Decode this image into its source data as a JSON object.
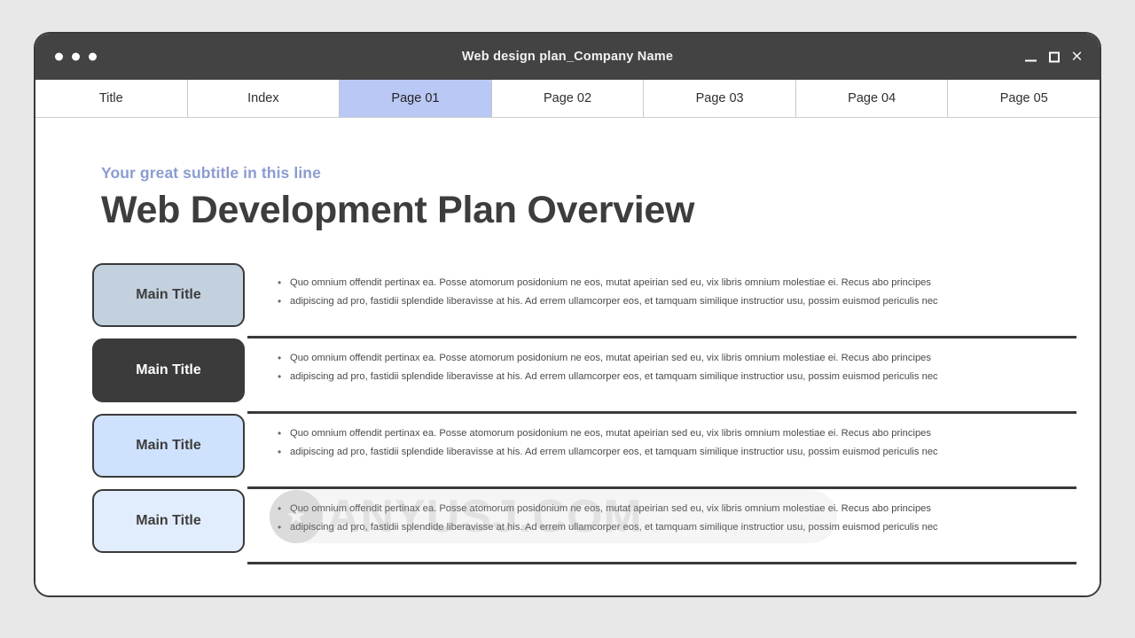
{
  "window": {
    "title": "Web design plan_Company Name",
    "controls": {
      "minimize": "minimize",
      "maximize": "maximize",
      "close": "×"
    }
  },
  "tabs": [
    {
      "label": "Title",
      "active": false
    },
    {
      "label": "Index",
      "active": false
    },
    {
      "label": "Page 01",
      "active": true
    },
    {
      "label": "Page 02",
      "active": false
    },
    {
      "label": "Page 03",
      "active": false
    },
    {
      "label": "Page 04",
      "active": false
    },
    {
      "label": "Page 05",
      "active": false
    }
  ],
  "slide": {
    "subtitle": "Your great subtitle in this line",
    "headline": "Web Development Plan Overview",
    "bullet_marker": "•",
    "rows": [
      {
        "title": "Main Title",
        "bg": "#c3d1de",
        "fg": "#3d3d3d",
        "bullets": [
          "Quo omnium offendit pertinax ea. Posse atomorum posidonium ne eos, mutat apeirian sed eu, vix libris omnium molestiae ei. Recus abo principes",
          "adipiscing ad pro, fastidii splendide liberavisse at his. Ad errem ullamcorper eos, et tamquam similique instructior usu, possim euismod periculis nec"
        ]
      },
      {
        "title": "Main Title",
        "bg": "#3b3b3b",
        "fg": "#ffffff",
        "bullets": [
          "Quo omnium offendit pertinax ea. Posse atomorum posidonium ne eos, mutat apeirian sed eu, vix libris omnium molestiae ei. Recus abo principes",
          "adipiscing ad pro, fastidii splendide liberavisse at his. Ad errem ullamcorper eos, et tamquam similique instructior usu, possim euismod periculis nec"
        ]
      },
      {
        "title": "Main Title",
        "bg": "#cfe2fd",
        "fg": "#3d3d3d",
        "bullets": [
          "Quo omnium offendit pertinax ea. Posse atomorum posidonium ne eos, mutat apeirian sed eu, vix libris omnium molestiae ei. Recus abo principes",
          "adipiscing ad pro, fastidii splendide liberavisse at his. Ad errem ullamcorper eos, et tamquam similique instructior usu, possim euismod periculis nec"
        ]
      },
      {
        "title": "Main Title",
        "bg": "#e1edfc",
        "fg": "#3d3d3d",
        "bullets": [
          "Quo omnium offendit pertinax ea. Posse atomorum posidonium ne eos, mutat apeirian sed eu, vix libris omnium molestiae ei. Recus abo principes",
          "adipiscing ad pro, fastidii splendide liberavisse at his. Ad errem ullamcorper eos, et tamquam similique instructior usu, possim euismod periculis nec"
        ]
      }
    ]
  },
  "watermark": {
    "text": "ANYUSJ.COM",
    "badge_glyph": "★"
  },
  "colors": {
    "accent_tab": "#b9c8f5",
    "subtitle": "#8c9cd1",
    "titlebar": "#434343",
    "page_bg": "#e8e8e8",
    "border": "#3a3a3a"
  }
}
